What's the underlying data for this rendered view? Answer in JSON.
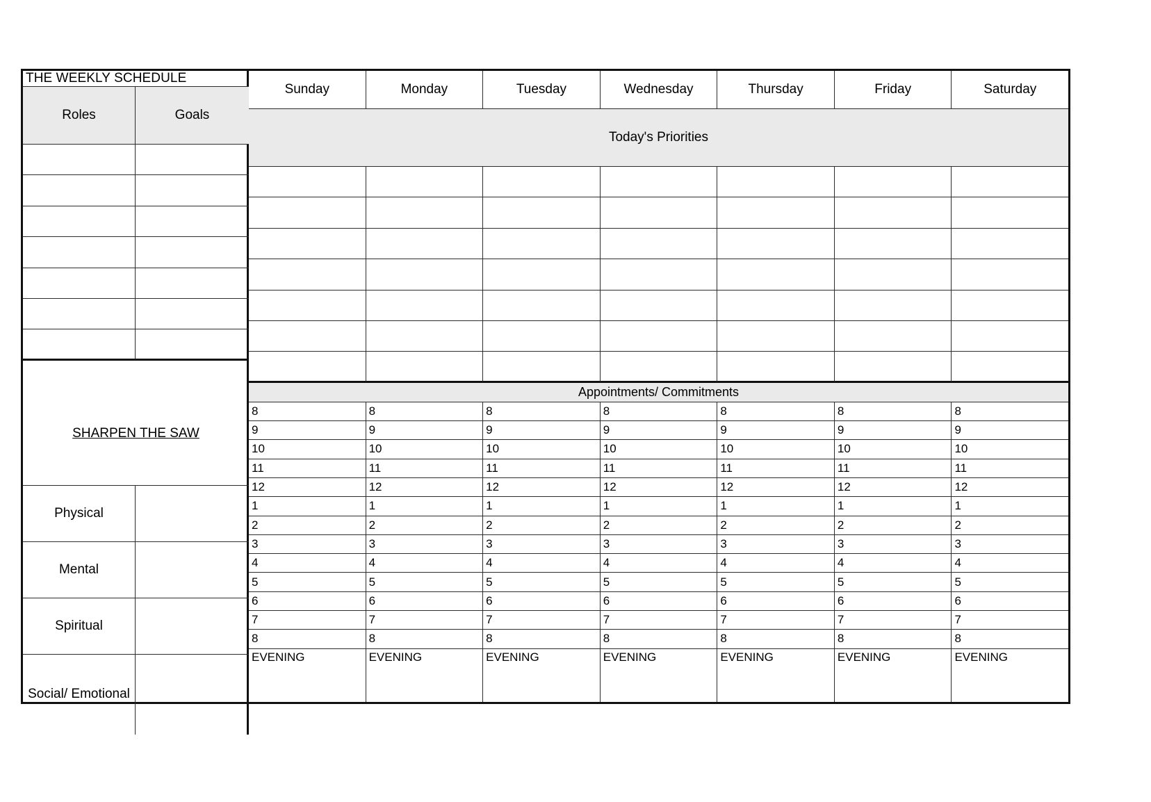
{
  "document": {
    "title": "THE WEEKLY SCHEDULE"
  },
  "header": {
    "days": [
      "Sunday",
      "Monday",
      "Tuesday",
      "Wednesday",
      "Thursday",
      "Friday",
      "Saturday"
    ]
  },
  "priorities": {
    "roles_label": "Roles",
    "goals_label": "Goals",
    "banner_label": "Today's Priorities",
    "row_count": 7
  },
  "appointments": {
    "banner_label": "Appointments/ Commitments",
    "hours": [
      "8",
      "9",
      "10",
      "11",
      "12",
      "1",
      "2",
      "3",
      "4",
      "5",
      "6",
      "7",
      "8"
    ],
    "evening_label": "EVENING"
  },
  "sharpen_the_saw": {
    "title": "SHARPEN THE SAW",
    "categories": [
      "Physical",
      "Mental",
      "Spiritual",
      "Social/ Emotional"
    ]
  },
  "colors": {
    "banner_fill": "#eaeaea",
    "border_heavy": "#111111",
    "border_light": "#2b2b2b",
    "page_background": "#ffffff",
    "text": "#000000"
  }
}
